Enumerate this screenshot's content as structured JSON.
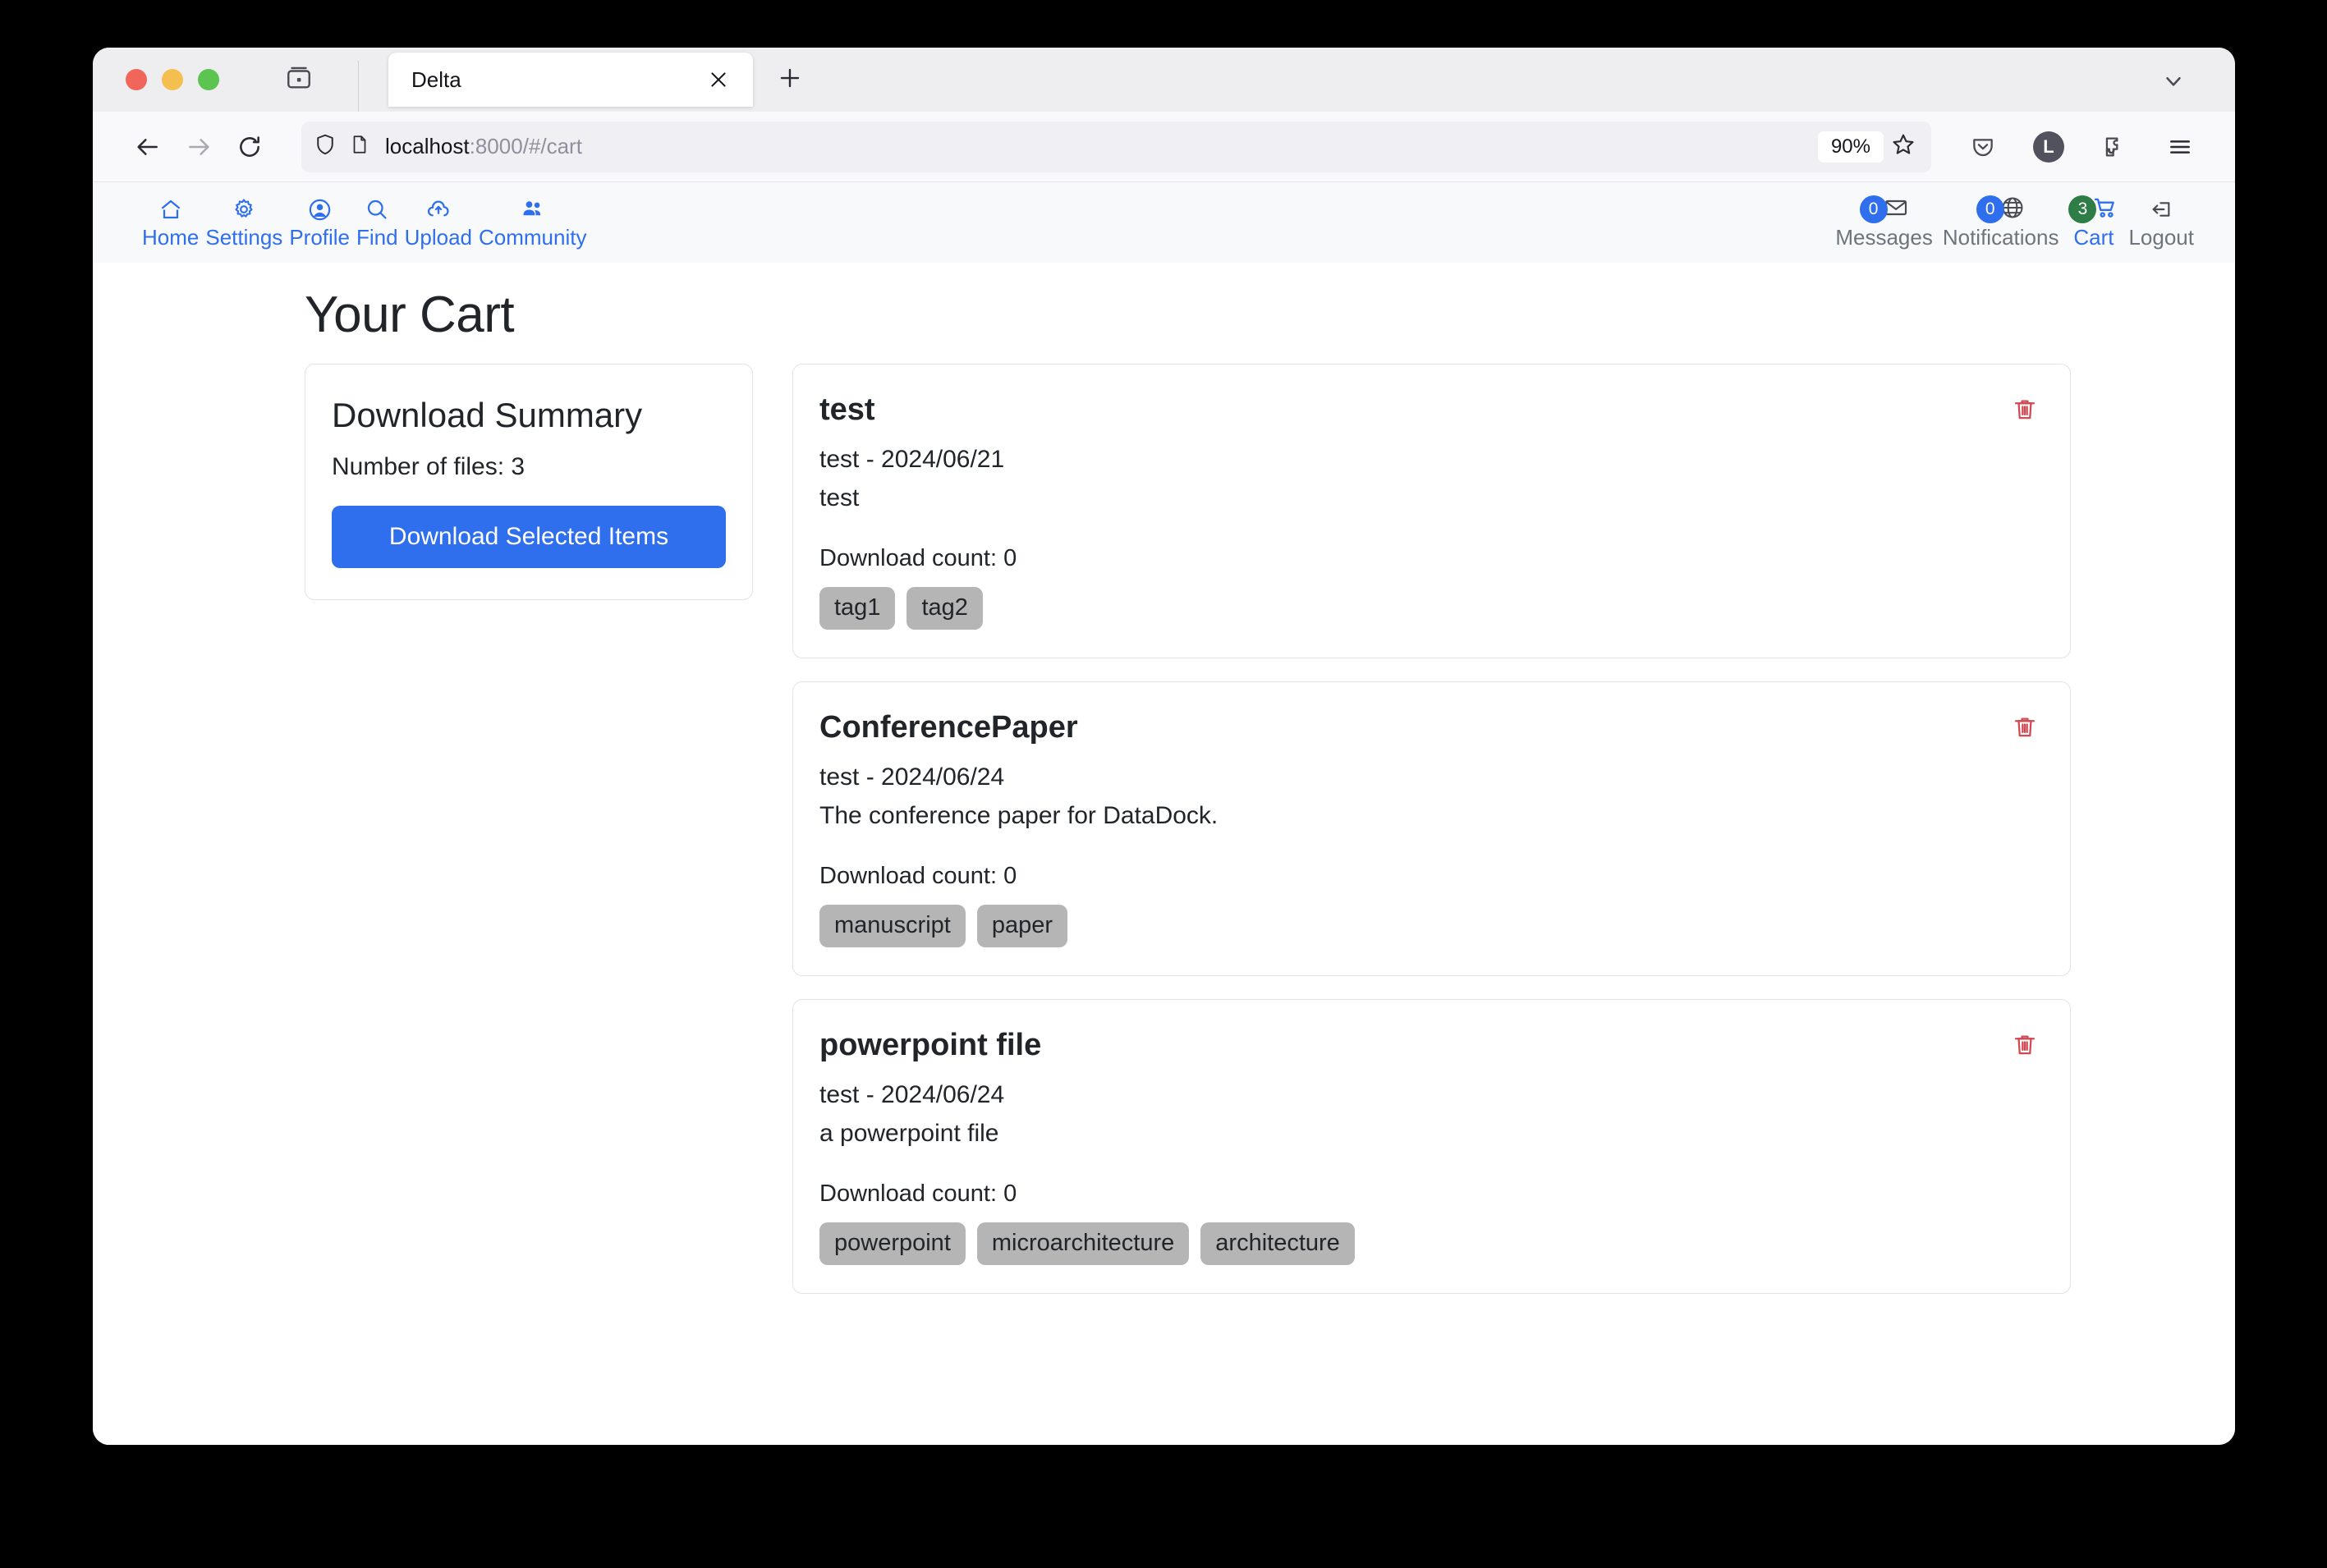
{
  "browser": {
    "tab": {
      "title": "Delta",
      "close_icon": "close-icon"
    },
    "new_tab_icon": "plus-icon",
    "tab_list_icon": "tab-list-icon",
    "all_tabs_icon": "chevron-down-icon",
    "back_icon": "arrow-left-icon",
    "forward_icon": "arrow-right-icon",
    "reload_icon": "reload-icon",
    "url": {
      "host": "localhost",
      "path": ":8000/#/cart"
    },
    "shield_icon": "shield-icon",
    "page_icon": "page-document-icon",
    "zoom_level": "90%",
    "bookmark_icon": "star-icon",
    "save_to_pocket_icon": "pocket-icon",
    "account_initial": "L",
    "extensions_icon": "extensions-icon",
    "menu_icon": "hamburger-menu-icon"
  },
  "appnav": {
    "left": [
      {
        "label": "Home",
        "icon": "home-icon"
      },
      {
        "label": "Settings",
        "icon": "gear-icon"
      },
      {
        "label": "Profile",
        "icon": "user-circle-icon"
      },
      {
        "label": "Find",
        "icon": "search-icon"
      },
      {
        "label": "Upload",
        "icon": "cloud-upload-icon"
      },
      {
        "label": "Community",
        "icon": "people-icon"
      }
    ],
    "right": [
      {
        "label": "Messages",
        "icon": "envelope-icon",
        "badge": "0",
        "badge_color": "#2f6fed",
        "active": false
      },
      {
        "label": "Notifications",
        "icon": "globe-icon",
        "badge": "0",
        "badge_color": "#2f6fed",
        "active": false
      },
      {
        "label": "Cart",
        "icon": "cart-icon",
        "badge": "3",
        "badge_color": "#2f7d46",
        "active": true
      },
      {
        "label": "Logout",
        "icon": "logout-icon",
        "badge": null,
        "active": false
      }
    ]
  },
  "page": {
    "title": "Your Cart",
    "summary": {
      "heading": "Download Summary",
      "files_line": "Number of files: 3",
      "button_label": "Download Selected Items"
    },
    "items": [
      {
        "title": "test",
        "meta": "test - 2024/06/21",
        "description": "test",
        "download_count": "Download count: 0",
        "tags": [
          "tag1",
          "tag2"
        ],
        "delete_icon": "trash-icon"
      },
      {
        "title": "ConferencePaper",
        "meta": "test - 2024/06/24",
        "description": "The conference paper for DataDock.",
        "download_count": "Download count: 0",
        "tags": [
          "manuscript",
          "paper"
        ],
        "delete_icon": "trash-icon"
      },
      {
        "title": "powerpoint file",
        "meta": "test - 2024/06/24",
        "description": "a powerpoint file",
        "download_count": "Download count: 0",
        "tags": [
          "powerpoint",
          "microarchitecture",
          "architecture"
        ],
        "delete_icon": "trash-icon"
      }
    ]
  },
  "colors": {
    "accent": "#2f6fed",
    "cart_badge": "#2f7d46",
    "danger": "#cf4a52",
    "tag_bg": "#b5b5b5"
  }
}
